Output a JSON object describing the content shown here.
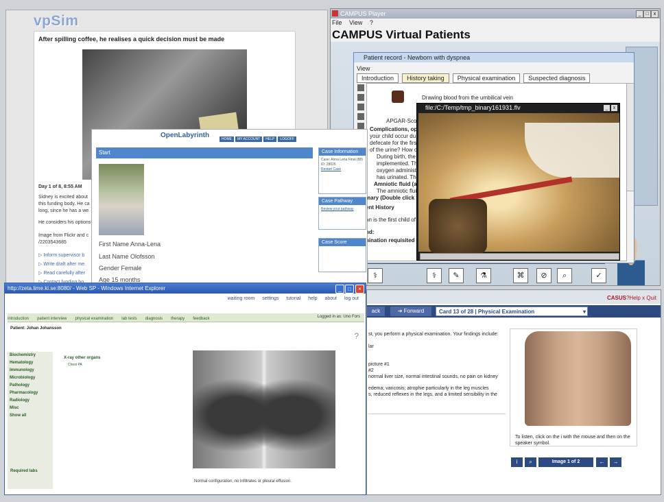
{
  "vpsim": {
    "logo": "vpSim",
    "headline": "After spilling coffee, he realises a quick decision must be made",
    "day": "Day 1 of 8, 8:55 AM",
    "body1": "Sidney is excited about",
    "body2": "this funding body. He ca",
    "body3": "long, since he has a we",
    "body4": "He considers his options",
    "body5": "Image from Flickr and c",
    "body6": "/2203543685",
    "options": [
      "Inform supervisor b",
      "Write draft after me",
      "Read carefully after",
      "Contact funding bo"
    ]
  },
  "campus": {
    "window_title": "CAMPUS Player",
    "menu": [
      "File",
      "View",
      "?"
    ],
    "heading": "CAMPUS Virtual Patients",
    "record": {
      "title": "Patient record - Newborn with dyspnea",
      "menu": "View",
      "tabs": [
        "Introduction",
        "History taking",
        "Physical examination",
        "Suspected diagnosis"
      ],
      "lines": [
        "Drawing blood from the umbilical vein",
        "APGAR-Score",
        "Complications, op",
        "your child occur du",
        "defecate for the firs",
        "of the urine? How c",
        "During birth, the n",
        "implemented. The",
        "oxygen administr",
        "has urinated. The",
        "Amniotic fluid (amn",
        "The amniotic fluid",
        "mary (Double click to",
        "ent History",
        "an is the first child of",
        "nd:",
        "nination requisited"
      ]
    },
    "video_title": "file:/C:/Temp/tmp_binary161931.flv"
  },
  "olab": {
    "logo": "OpenLabyrinth",
    "nav": [
      "HOME",
      "MY ACCOUNT",
      "HELP",
      "LOGOFF"
    ],
    "start": "Start",
    "fields": [
      "First Name Anna-Lena",
      "Last Name Olofsson",
      "Gender Female",
      "Age 15 months"
    ],
    "case_info_title": "Case Information",
    "case_info": "Case: Anna Lena Final (88) ID: 28026",
    "case_info_link": "Restart Case",
    "pathway_title": "Case Pathway",
    "pathway_link": "Review your pathway",
    "score_title": "Case Score"
  },
  "ie": {
    "title": "http://zeta.lime.ki.se:8080/ - Web SP - Windows Internet Explorer",
    "links": [
      "waiting room",
      "settings",
      "tutorial",
      "help",
      "about",
      "log out"
    ],
    "tabs": [
      "introduction",
      "patient interview",
      "physical examination",
      "lab tests",
      "diagnosis",
      "therapy",
      "feedback"
    ],
    "logged": "Logged in as: Uno Fors",
    "patient": "Patient: Johan Johansson",
    "help": "?",
    "labs": [
      "Biochemistry",
      "Hematology",
      "Immunology",
      "Microbiology",
      "Pathology",
      "Pharmacology",
      "Radiology",
      "Misc",
      "Show all"
    ],
    "required": "Required labs",
    "organ": "X-ray other organs",
    "chest": "Chest PA",
    "caption": "Normal configuration, no infiltrates or pleural effusion."
  },
  "casus": {
    "logo": "CASUS",
    "help": "?Help",
    "quit": "x Quit",
    "back": "ack",
    "forward": "Forward",
    "card": "Card 13 of 28 | Physical Examination",
    "lines": [
      "st, you perform a physical examination. Your findings include:",
      "lar",
      "picture #1",
      "#2",
      "normal liver size, normal intestinal sounds, no pain on kidney",
      "edema; varicosis; atrophie particularly in the leg muscles",
      "s, reduced reflexes in the legs, and a limited sensibility in the"
    ],
    "caption": "To listen, click on the i with the mouse and then on the speaker symbol.",
    "image_label": "Image 1 of 2",
    "accent": "#2e4a82"
  }
}
